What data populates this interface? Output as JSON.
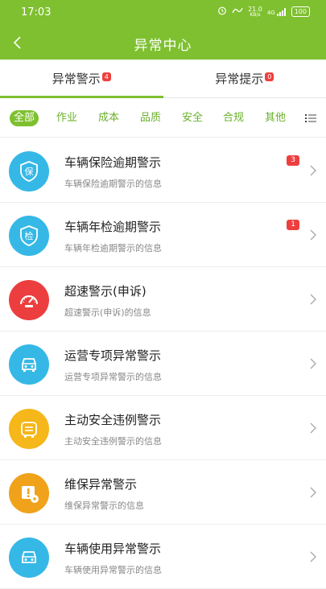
{
  "status": {
    "time": "17:03",
    "speed": "21.0",
    "speed_unit": "KB/s",
    "network": "4G",
    "battery": "100"
  },
  "header": {
    "title": "异常中心"
  },
  "tabs": [
    {
      "label": "异常警示",
      "badge": "4"
    },
    {
      "label": "异常提示",
      "badge": "0"
    }
  ],
  "filters": [
    "全部",
    "作业",
    "成本",
    "品质",
    "安全",
    "合规",
    "其他"
  ],
  "items": [
    {
      "title": "车辆保险逾期警示",
      "desc": "车辆保险逾期警示的信息",
      "count": "3",
      "icon": "insurance-icon",
      "color": "#36b8e6",
      "glyph": "保"
    },
    {
      "title": "车辆年检逾期警示",
      "desc": "车辆年检逾期警示的信息",
      "count": "1",
      "icon": "inspection-icon",
      "color": "#36b8e6",
      "glyph": "检"
    },
    {
      "title": "超速警示(申诉)",
      "desc": "超速警示(申诉)的信息",
      "count": "",
      "icon": "speedometer-icon",
      "color": "#ec3e3e",
      "glyph": ""
    },
    {
      "title": "运营专项异常警示",
      "desc": "运营专项异常警示的信息",
      "count": "",
      "icon": "car-icon",
      "color": "#36b8e6",
      "glyph": ""
    },
    {
      "title": "主动安全违例警示",
      "desc": "主动安全违例警示的信息",
      "count": "",
      "icon": "safety-icon",
      "color": "#f5b719",
      "glyph": ""
    },
    {
      "title": "维保异常警示",
      "desc": "维保异常警示的信息",
      "count": "",
      "icon": "maintenance-icon",
      "color": "#f0a21a",
      "glyph": ""
    },
    {
      "title": "车辆使用异常警示",
      "desc": "车辆使用异常警示的信息",
      "count": "",
      "icon": "car-usage-icon",
      "color": "#36b8e6",
      "glyph": ""
    }
  ]
}
